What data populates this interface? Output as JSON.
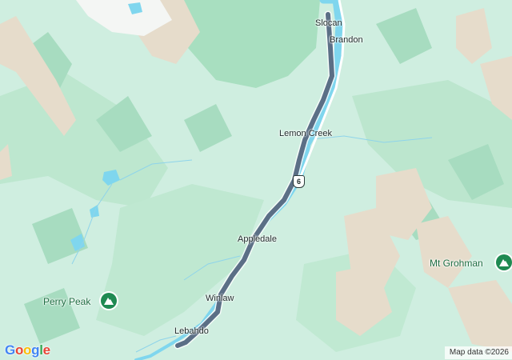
{
  "map": {
    "places": [
      {
        "id": "slocan",
        "label": "Slocan"
      },
      {
        "id": "brandon",
        "label": "Brandon"
      },
      {
        "id": "lemon-creek",
        "label": "Lemon Creek"
      },
      {
        "id": "appledale",
        "label": "Appledale"
      },
      {
        "id": "winlaw",
        "label": "Winlaw"
      },
      {
        "id": "lebahdo",
        "label": "Lebahdo"
      }
    ],
    "peaks": [
      {
        "id": "perry-peak",
        "label": "Perry Peak",
        "icon": "mountain-icon"
      },
      {
        "id": "mt-grohman",
        "label": "Mt Grohman",
        "icon": "mountain-icon"
      }
    ],
    "highway_shield": "6",
    "attribution": "Map data ©2026",
    "logo": {
      "letters": [
        "G",
        "o",
        "o",
        "g",
        "l",
        "e"
      ]
    },
    "colors": {
      "base_green": "#cfeee0",
      "forest": "#b3e3c8",
      "dark_forest": "#9fd9b8",
      "bare_ridge": "#e8dccd",
      "water": "#7fd6ee",
      "route": "#5b6f86",
      "peak_icon": "#1f8a52",
      "logo": [
        "#4285F4",
        "#EA4335",
        "#FBBC05",
        "#4285F4",
        "#34A853",
        "#EA4335"
      ]
    }
  }
}
